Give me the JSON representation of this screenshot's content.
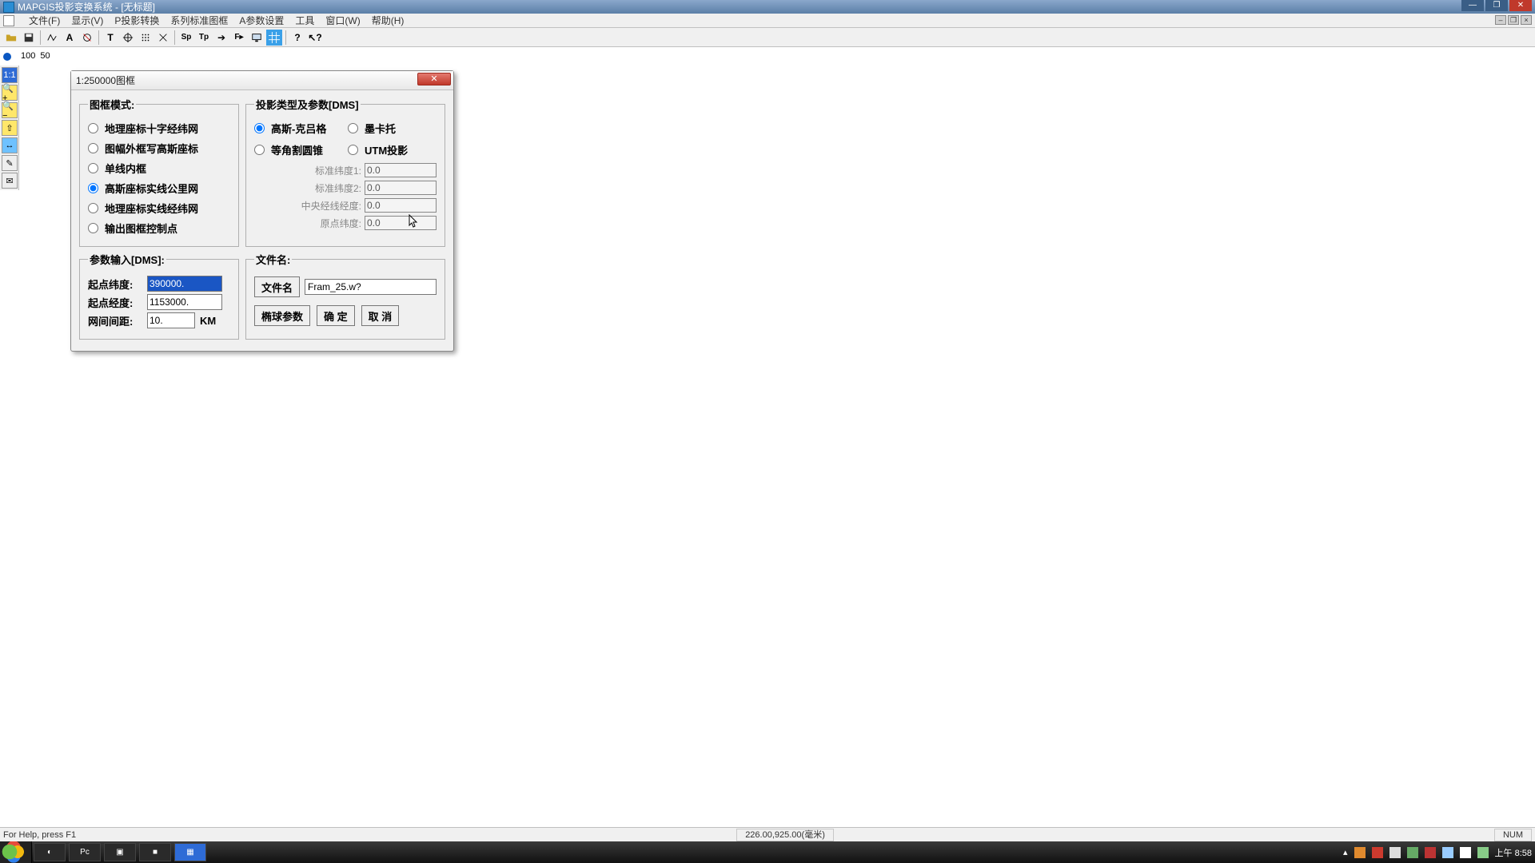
{
  "app": {
    "title": "MAPGIS投影变换系统 - [无标题]",
    "win_min": "—",
    "win_max": "❐",
    "win_close": "✕"
  },
  "menu": {
    "file": "文件(F)",
    "view": "显示(V)",
    "proj": "P投影转换",
    "series": "系列标准图框",
    "aparam": "A参数设置",
    "tools": "工具",
    "window": "窗口(W)",
    "help": "帮助(H)"
  },
  "mdi": {
    "min": "–",
    "restore": "❐",
    "close": "×"
  },
  "toolbar_icons": [
    "open",
    "save",
    "|",
    "line",
    "text",
    "circ",
    "|",
    "t",
    "target",
    "grid",
    "x",
    "|",
    "sp",
    "tp",
    "arrow",
    "fp",
    "mon",
    "bluegrid",
    "|",
    "q",
    "qcur"
  ],
  "ruler": [
    "100",
    "50"
  ],
  "vtool": [
    "1:1",
    "🔍+",
    "🔍−",
    "⇧",
    "↔",
    "✎",
    "✉"
  ],
  "dialog": {
    "title": "1:250000图框",
    "close": "✕",
    "frame_legend": "图框模式:",
    "frame_options": [
      "地理座标十字经纬网",
      "图幅外框写高斯座标",
      "单线内框",
      "高斯座标实线公里网",
      "地理座标实线经纬网",
      "输出图框控制点"
    ],
    "frame_selected_index": 3,
    "proj_legend": "投影类型及参数[DMS]",
    "proj_options": [
      "高斯-克吕格",
      "墨卡托",
      "等角割圆锥",
      "UTM投影"
    ],
    "proj_selected_index": 0,
    "params": {
      "std_lat1_label": "标准纬度1:",
      "std_lat1": "0.0",
      "std_lat2_label": "标准纬度2:",
      "std_lat2": "0.0",
      "central_label": "中央经线经度:",
      "central": "0.0",
      "origin_label": "原点纬度:",
      "origin": "0.0"
    },
    "input_legend": "参数输入[DMS]:",
    "inputs": {
      "lat_label": "起点纬度:",
      "lat": "390000.",
      "lon_label": "起点经度:",
      "lon": "1153000.",
      "spacing_label": "网间间距:",
      "spacing": "10.",
      "spacing_unit": "KM"
    },
    "file_legend": "文件名:",
    "file_btn": "文件名",
    "file_value": "Fram_25.w?",
    "btn_ellip": "椭球参数",
    "btn_ok": "确  定",
    "btn_cancel": "取  消"
  },
  "status": {
    "help": "For Help, press F1",
    "coord": "226.00,925.00(毫米)",
    "num": "NUM"
  },
  "taskbar": {
    "items": [
      "◐",
      "Pc",
      "▣",
      "■",
      "▦"
    ],
    "clock": "上午 8:58",
    "tray_count": 10,
    "tray_arrow": "▴"
  }
}
